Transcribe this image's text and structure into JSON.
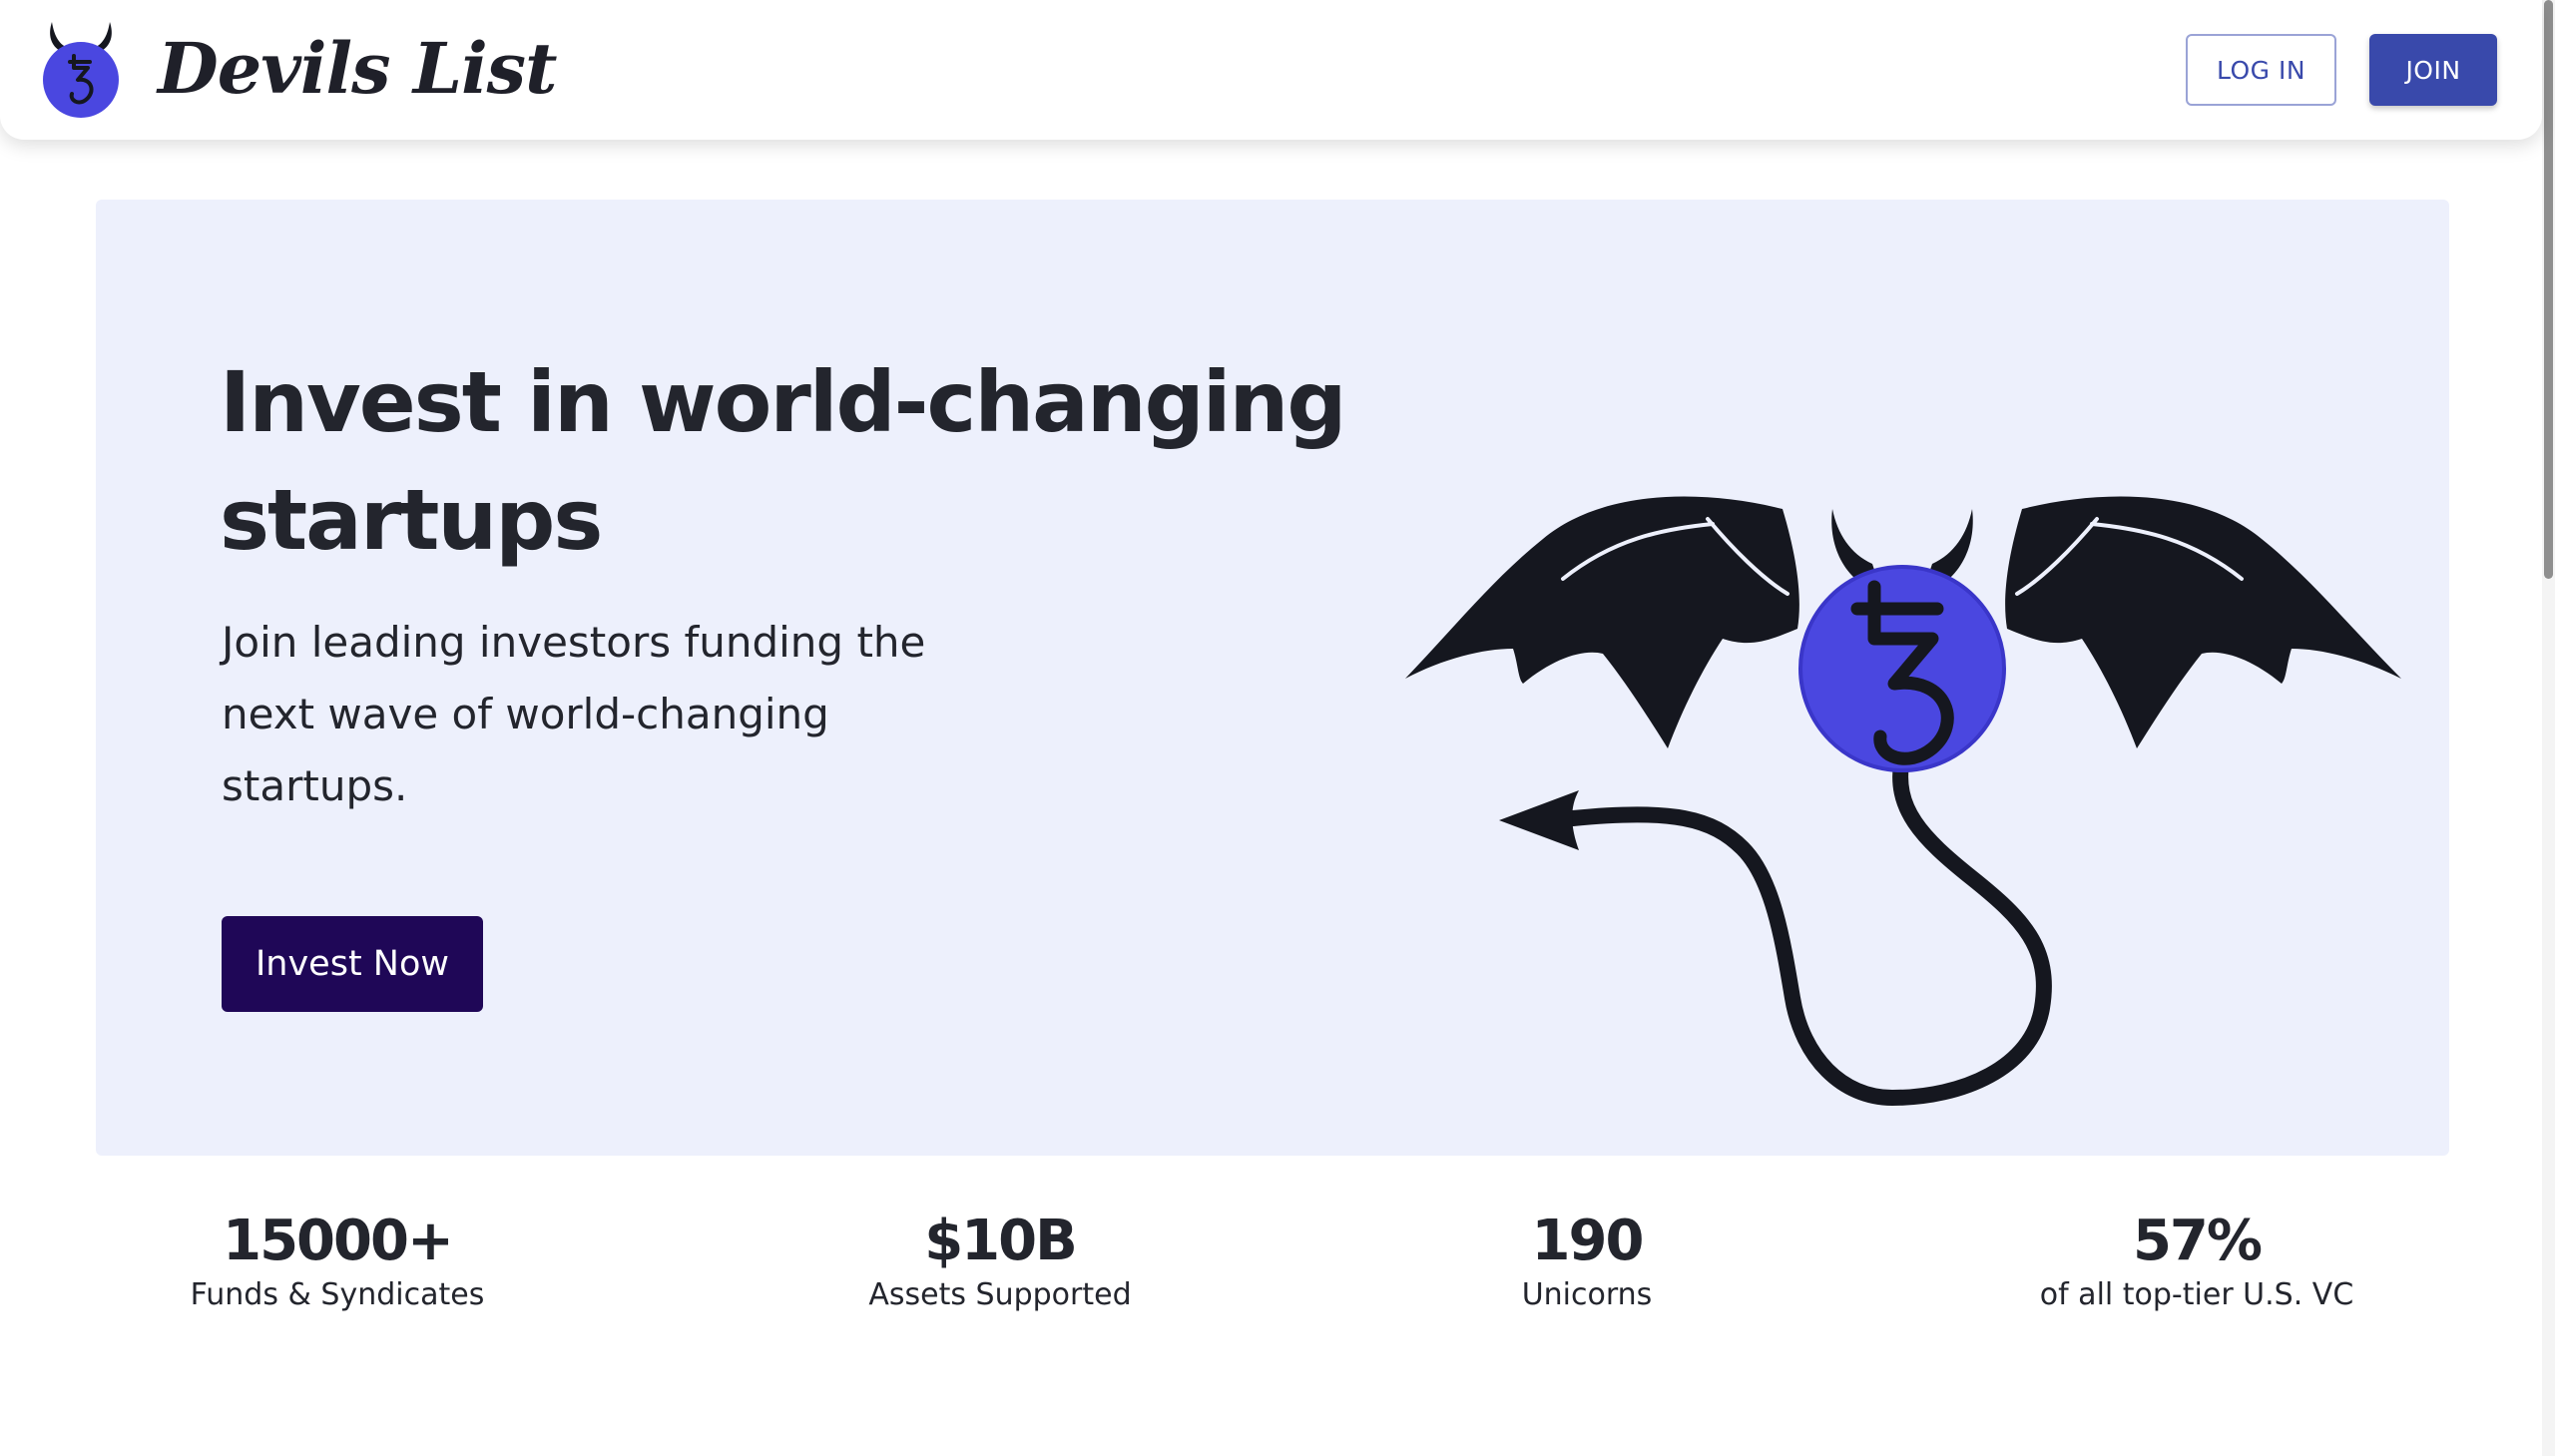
{
  "header": {
    "brand_name": "Devils List",
    "brand_icon": "devil-coin-logo-icon",
    "login_label": "LOG IN",
    "join_label": "JOIN"
  },
  "hero": {
    "title": "Invest in world-changing startups",
    "subtitle": "Join leading investors funding the next wave of world-changing startups.",
    "cta_label": "Invest Now",
    "illustration_icon": "winged-devil-coin-icon"
  },
  "stats": [
    {
      "value": "15000+",
      "label": "Funds & Syndicates"
    },
    {
      "value": "$10B",
      "label": "Assets Supported"
    },
    {
      "value": "190",
      "label": "Unicorns"
    },
    {
      "value": "57%",
      "label": "of all top-tier U.S. VC"
    }
  ],
  "colors": {
    "accent": "#3949ab",
    "cta": "#1f0757",
    "coin": "#4a47e0",
    "hero_bg": "#edf0fc",
    "ink": "#1d1f26"
  }
}
